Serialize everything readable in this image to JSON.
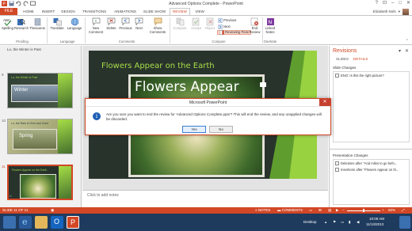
{
  "window": {
    "title": "Advanced Options Complete - PowerPoint",
    "controls": [
      "?",
      "–",
      "□",
      "✕"
    ]
  },
  "tabs": {
    "file": "FILE",
    "items": [
      "HOME",
      "INSERT",
      "DESIGN",
      "TRANSITIONS",
      "ANIMATIONS",
      "SLIDE SHOW",
      "REVIEW",
      "VIEW"
    ],
    "active": "REVIEW"
  },
  "user": {
    "name": "Elizabeth Nofs"
  },
  "ribbon": {
    "proofing": {
      "label": "Proofing",
      "spelling": "Spelling",
      "research": "Research",
      "thesaurus": "Thesaurus"
    },
    "language": {
      "label": "Language",
      "translate": "Translate",
      "language": "Language"
    },
    "comments": {
      "label": "Comments",
      "new_comment": "New Comment",
      "delete": "Delete",
      "previous": "Previous",
      "next": "Next",
      "show_comments": "Show Comments"
    },
    "compare": {
      "label": "Compare",
      "compare": "Compare",
      "accept": "Accept",
      "reject": "Reject",
      "previous": "Previous",
      "next": "Next",
      "reviewing_pane": "Reviewing Pane",
      "end_review": "End Review"
    },
    "onenote": {
      "label": "OneNote",
      "linked_notes": "Linked Notes"
    }
  },
  "thumbnails": {
    "caption": "Lo, the Winter is Past",
    "slides": [
      {
        "num": "9",
        "title": "Lo, the Winter is Past",
        "big": "Winter"
      },
      {
        "num": "10",
        "title": "Lo, the Rain is Over and Gone",
        "big": "Spring"
      },
      {
        "num": "11",
        "title": "Flowers Appear on the Earth",
        "big": ""
      }
    ]
  },
  "slide": {
    "title": "Flowers Appear on the Earth",
    "big": "Flowers Appear"
  },
  "notes": {
    "placeholder": "Click to add notes"
  },
  "revisions": {
    "title": "Revisions",
    "tabs": [
      "SLIDES",
      "DETAILS"
    ],
    "slide_changes_label": "Slide Changes",
    "slide_changes": [
      "ENO: Is this the right picture?"
    ],
    "presentation_changes_label": "Presentation Changes",
    "presentation_changes": [
      "Deletions after \"And miles to go befo...",
      "Insertions after \"Flowers Appear on th..."
    ]
  },
  "dialog": {
    "title": "Microsoft PowerPoint",
    "message": "Are you sure you want to end the review for 'Advanced Options Complete.pptx'? This will end the review, and any unapplied changes will be discarded.",
    "yes": "Yes",
    "no": "No"
  },
  "statusbar": {
    "slide": "SLIDE 11 OF 11",
    "notes": "NOTES",
    "comments": "COMMENTS",
    "zoom": "50%",
    "zoom_level": 0.5
  },
  "taskbar": {
    "desktop": "Desktop",
    "time": "10:09 AM",
    "date": "11/13/2013"
  },
  "colors": {
    "accent": "#d24726",
    "taskbar": "#1e3b5e",
    "slide_title": "#a7de46"
  }
}
